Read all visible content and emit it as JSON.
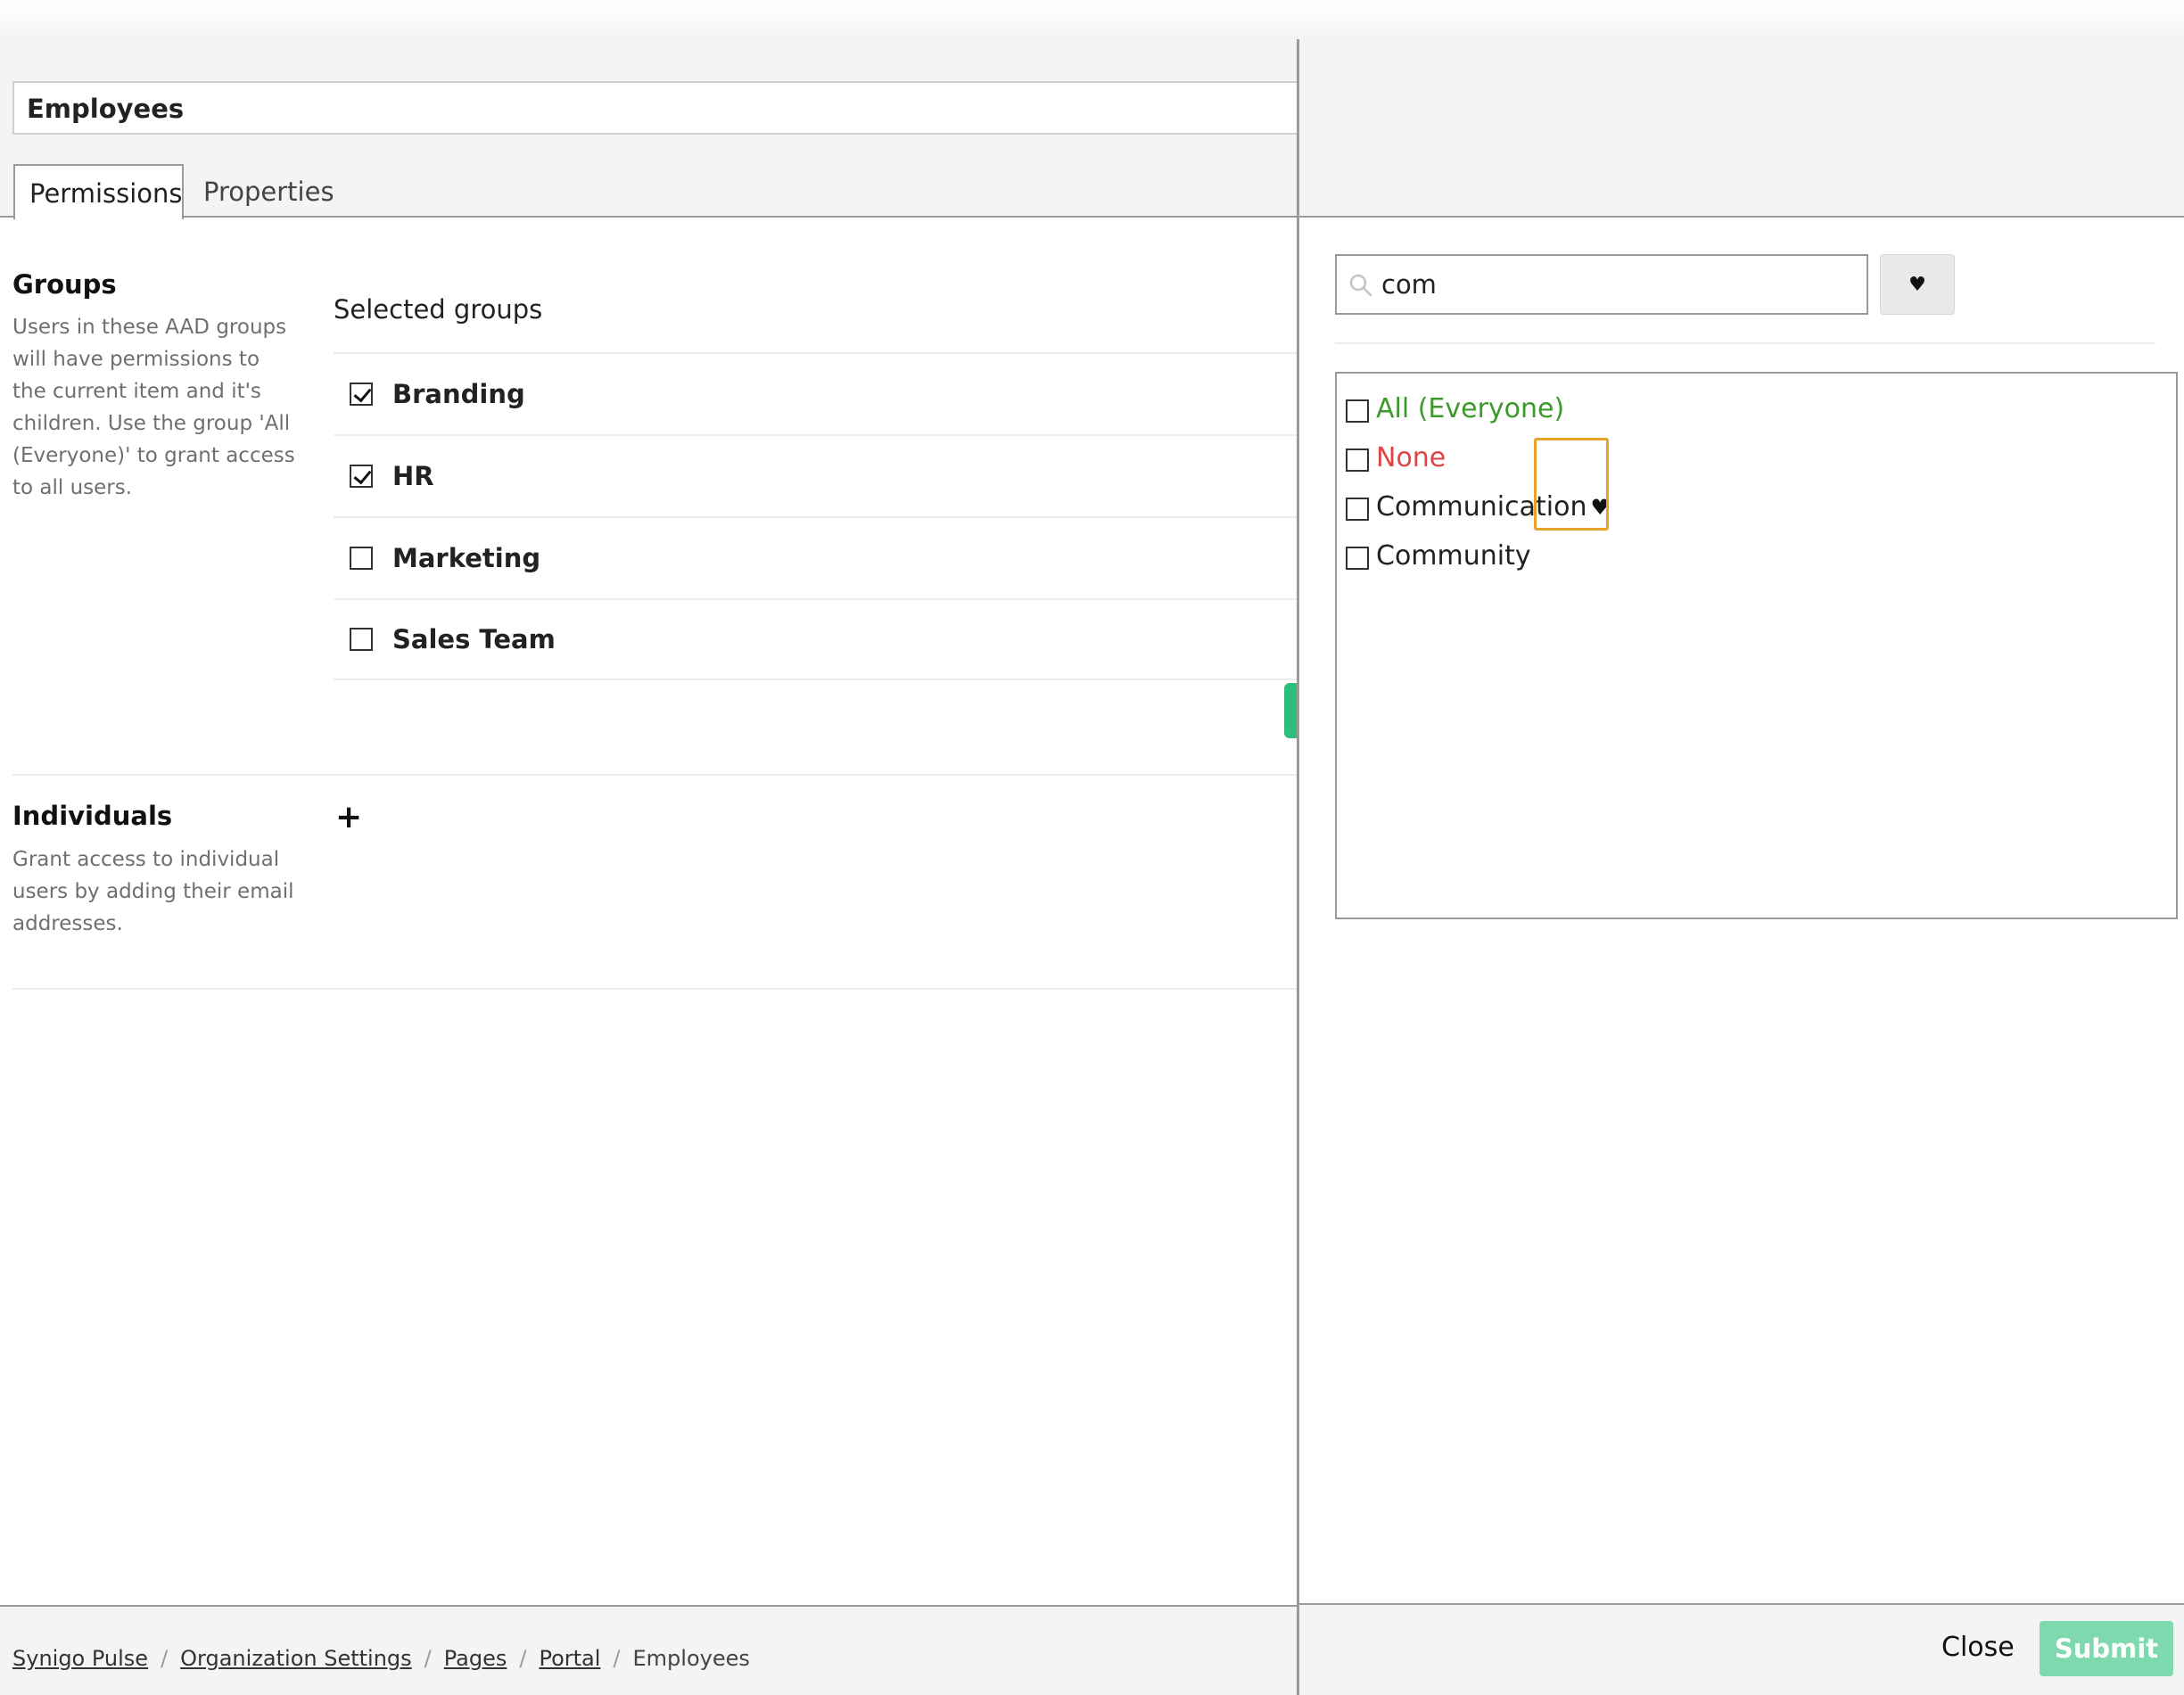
{
  "page": {
    "title": "Employees",
    "tabs": [
      {
        "label": "Permissions",
        "active": true
      },
      {
        "label": "Properties",
        "active": false
      }
    ]
  },
  "groups": {
    "title": "Groups",
    "description": "Users in these AAD groups will have permissions to the current item and it's children. Use the group 'All (Everyone)' to grant access to all users.",
    "selected_label": "Selected groups",
    "items": [
      {
        "name": "Branding",
        "checked": true
      },
      {
        "name": "HR",
        "checked": true
      },
      {
        "name": "Marketing",
        "checked": false
      },
      {
        "name": "Sales Team",
        "checked": false
      }
    ]
  },
  "individuals": {
    "title": "Individuals",
    "description": "Grant access to individual users by adding their email addresses.",
    "add_symbol": "+"
  },
  "breadcrumb": {
    "items": [
      "Synigo Pulse",
      "Organization Settings",
      "Pages",
      "Portal"
    ],
    "current": "Employees",
    "separator": "/"
  },
  "panel": {
    "search": {
      "value": "com"
    },
    "favorite_icon": "♥",
    "results": [
      {
        "label": "All (Everyone)",
        "checked": false,
        "style": "everyone"
      },
      {
        "label": "None",
        "checked": false,
        "style": "none"
      },
      {
        "label": "Communication",
        "checked": false,
        "style": "normal",
        "favorite": true
      },
      {
        "label": "Community",
        "checked": false,
        "style": "normal",
        "favorite": false
      }
    ],
    "close_label": "Close",
    "submit_label": "Submit"
  },
  "colors": {
    "accent_green": "#2dbe7e",
    "submit_disabled": "#7fd9ae",
    "everyone_green": "#3c9a2c",
    "none_red": "#e04444",
    "highlight_orange": "#e8a32a"
  }
}
